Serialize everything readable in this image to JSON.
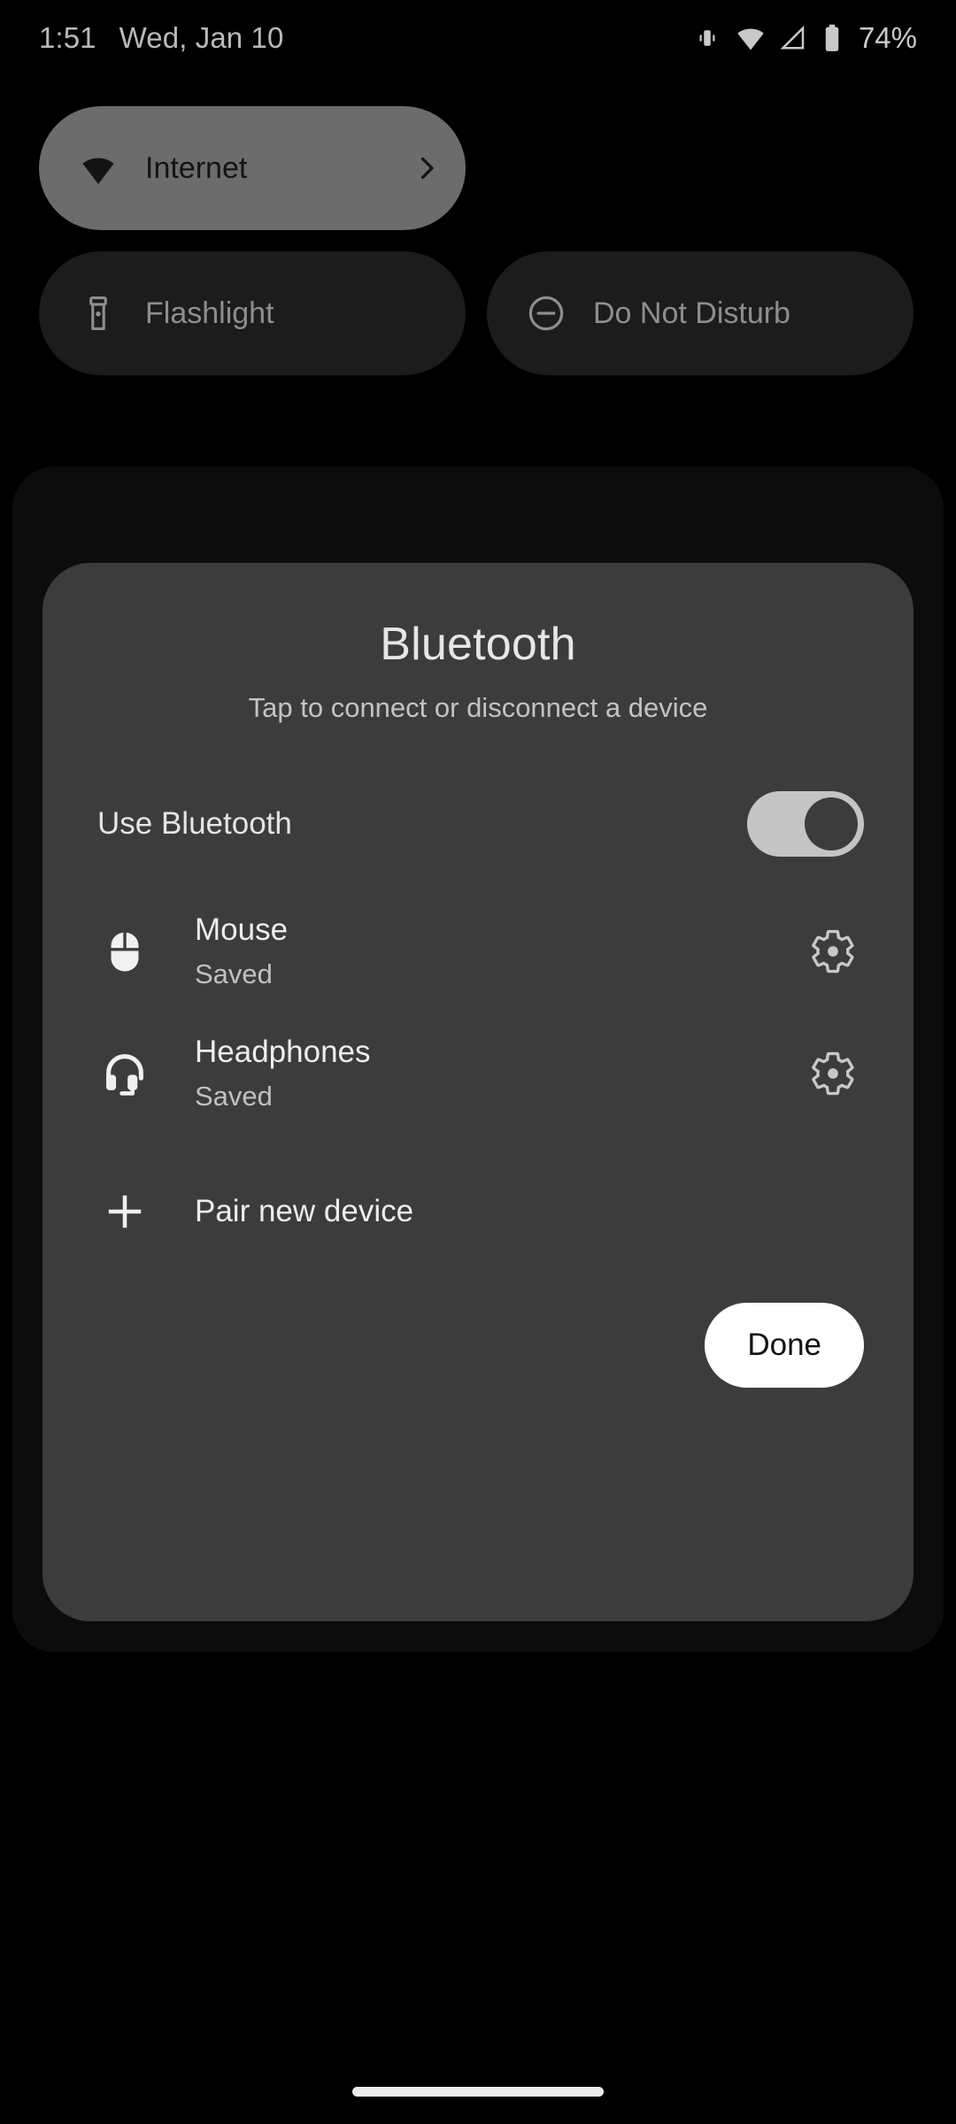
{
  "status_bar": {
    "time": "1:51",
    "date": "Wed, Jan 10",
    "battery_percent": "74%",
    "icons": [
      "vibrate-icon",
      "wifi-icon",
      "cellular-signal-icon",
      "battery-icon"
    ]
  },
  "quick_settings": {
    "tiles": [
      {
        "label": "Internet",
        "icon": "wifi-icon",
        "state": "active",
        "has_chevron": true
      },
      {
        "label": "Flashlight",
        "icon": "flashlight-icon",
        "state": "inactive",
        "has_chevron": false
      },
      {
        "label": "Do Not Disturb",
        "icon": "do-not-disturb-icon",
        "state": "inactive",
        "has_chevron": false
      }
    ]
  },
  "bluetooth_dialog": {
    "title": "Bluetooth",
    "subtitle": "Tap to connect or disconnect a device",
    "use_bluetooth": {
      "label": "Use Bluetooth",
      "enabled": true
    },
    "devices": [
      {
        "name": "Mouse",
        "status": "Saved",
        "icon": "mouse-icon",
        "settings_icon": "gear-icon"
      },
      {
        "name": "Headphones",
        "status": "Saved",
        "icon": "headphones-icon",
        "settings_icon": "gear-icon"
      }
    ],
    "pair_new_device": {
      "label": "Pair new device",
      "icon": "plus-icon"
    },
    "done_label": "Done"
  },
  "colors": {
    "background": "#000000",
    "dialog": "#3c3c3c",
    "tile_active": "#6c6c6c",
    "tile_inactive": "#1c1c1c",
    "accent_button": "#ffffff",
    "toggle_track": "#c4c4c4"
  }
}
